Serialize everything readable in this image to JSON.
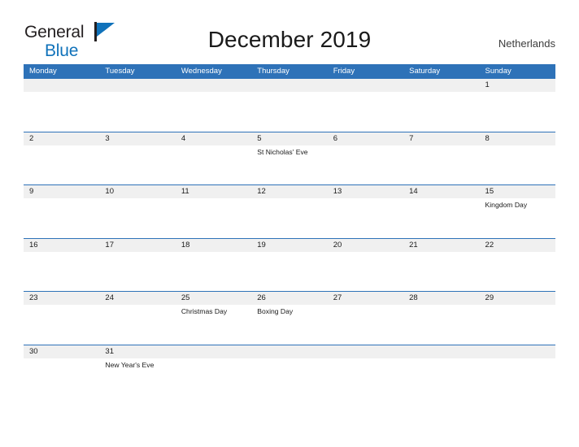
{
  "brand": {
    "name_top": "General",
    "name_bottom": "Blue",
    "flag_icon": "flag-triangle-icon",
    "accent_color": "#1072ba"
  },
  "header": {
    "title": "December 2019",
    "region": "Netherlands"
  },
  "colors": {
    "header_blue": "#2e72b8",
    "row_band_gray": "#f0f0f0",
    "text_dark": "#1a1a1a"
  },
  "calendar": {
    "weekdays": [
      "Monday",
      "Tuesday",
      "Wednesday",
      "Thursday",
      "Friday",
      "Saturday",
      "Sunday"
    ],
    "weeks": [
      {
        "days": [
          {
            "num": "",
            "event": ""
          },
          {
            "num": "",
            "event": ""
          },
          {
            "num": "",
            "event": ""
          },
          {
            "num": "",
            "event": ""
          },
          {
            "num": "",
            "event": ""
          },
          {
            "num": "",
            "event": ""
          },
          {
            "num": "1",
            "event": ""
          }
        ]
      },
      {
        "days": [
          {
            "num": "2",
            "event": ""
          },
          {
            "num": "3",
            "event": ""
          },
          {
            "num": "4",
            "event": ""
          },
          {
            "num": "5",
            "event": "St Nicholas' Eve"
          },
          {
            "num": "6",
            "event": ""
          },
          {
            "num": "7",
            "event": ""
          },
          {
            "num": "8",
            "event": ""
          }
        ]
      },
      {
        "days": [
          {
            "num": "9",
            "event": ""
          },
          {
            "num": "10",
            "event": ""
          },
          {
            "num": "11",
            "event": ""
          },
          {
            "num": "12",
            "event": ""
          },
          {
            "num": "13",
            "event": ""
          },
          {
            "num": "14",
            "event": ""
          },
          {
            "num": "15",
            "event": "Kingdom Day"
          }
        ]
      },
      {
        "days": [
          {
            "num": "16",
            "event": ""
          },
          {
            "num": "17",
            "event": ""
          },
          {
            "num": "18",
            "event": ""
          },
          {
            "num": "19",
            "event": ""
          },
          {
            "num": "20",
            "event": ""
          },
          {
            "num": "21",
            "event": ""
          },
          {
            "num": "22",
            "event": ""
          }
        ]
      },
      {
        "days": [
          {
            "num": "23",
            "event": ""
          },
          {
            "num": "24",
            "event": ""
          },
          {
            "num": "25",
            "event": "Christmas Day"
          },
          {
            "num": "26",
            "event": "Boxing Day"
          },
          {
            "num": "27",
            "event": ""
          },
          {
            "num": "28",
            "event": ""
          },
          {
            "num": "29",
            "event": ""
          }
        ]
      },
      {
        "days": [
          {
            "num": "30",
            "event": ""
          },
          {
            "num": "31",
            "event": "New Year's Eve"
          },
          {
            "num": "",
            "event": ""
          },
          {
            "num": "",
            "event": ""
          },
          {
            "num": "",
            "event": ""
          },
          {
            "num": "",
            "event": ""
          },
          {
            "num": "",
            "event": ""
          }
        ]
      }
    ]
  }
}
